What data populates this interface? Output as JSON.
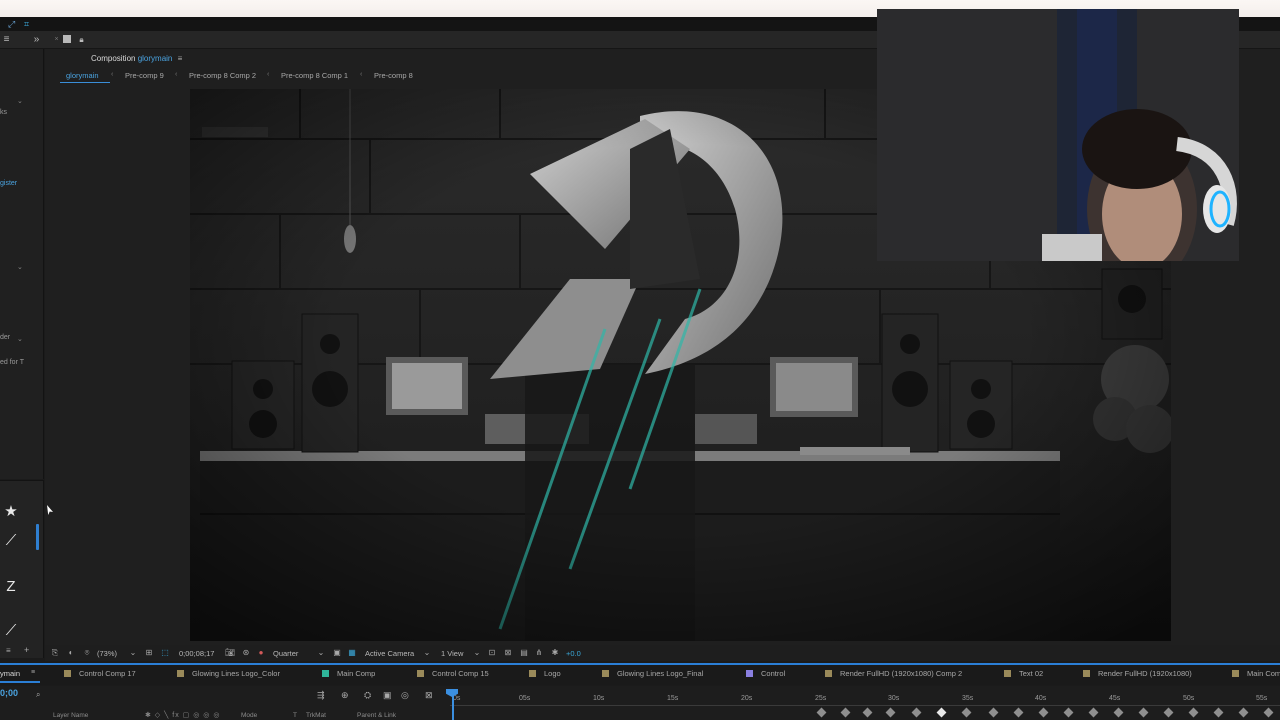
{
  "composition": {
    "panel_label": "Composition",
    "name": "glorymain",
    "breadcrumbs": [
      "glorymain",
      "Pre-comp 9",
      "Pre-comp 8 Comp 2",
      "Pre-comp 8 Comp 1",
      "Pre-comp 8"
    ]
  },
  "left_panel": {
    "fragments": [
      "ks",
      "gister",
      "der",
      "ed for T"
    ]
  },
  "viewer_toolbar": {
    "zoom": "(73%)",
    "timecode": "0;00;08;17",
    "resolution": "Quarter",
    "camera": "Active Camera",
    "views": "1 View",
    "exposure": "+0.0"
  },
  "timeline": {
    "current_tab": "ymain",
    "timecode": "0;00",
    "tabs": [
      {
        "label": "Control Comp 17",
        "color": "#9a8a5a"
      },
      {
        "label": "Glowing Lines Logo_Color",
        "color": "#9a8a5a"
      },
      {
        "label": "Main Comp",
        "color": "#2fb59a"
      },
      {
        "label": "Control Comp 15",
        "color": "#9a8a5a"
      },
      {
        "label": "Logo",
        "color": "#9a8a5a"
      },
      {
        "label": "Glowing Lines Logo_Final",
        "color": "#9a8a5a"
      },
      {
        "label": "Control",
        "color": "#8a7fe0"
      },
      {
        "label": "Render FullHD (1920x1080) Comp 2",
        "color": "#9a8a5a"
      },
      {
        "label": "Text 02",
        "color": "#9a8a5a"
      },
      {
        "label": "Render FullHD (1920x1080)",
        "color": "#9a8a5a"
      },
      {
        "label": "Main Com",
        "color": "#9a8a5a"
      }
    ],
    "ruler": [
      "0s",
      "05s",
      "10s",
      "15s",
      "20s",
      "25s",
      "30s",
      "35s",
      "40s",
      "45s",
      "50s",
      "55s"
    ],
    "columns": {
      "layer_name": "Layer Name",
      "mode": "Mode",
      "t": "T",
      "trkmat": "TrkMat",
      "parent": "Parent & Link"
    }
  }
}
